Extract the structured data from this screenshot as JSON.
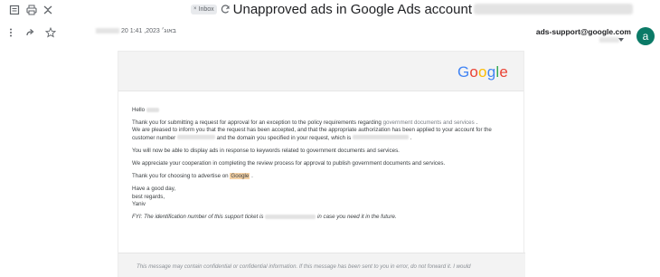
{
  "toolbar": {
    "icons": [
      "print-icon",
      "printer-icon",
      "collapse-icon"
    ]
  },
  "subject": {
    "inbox_chip": "Inbox",
    "chip_close": "×",
    "text": "Unapproved ads in Google Ads account"
  },
  "header": {
    "date": "20 באוג׳ 2023, 1:41",
    "sender": "ads-support@google.com",
    "avatar_letter": "a"
  },
  "email": {
    "logo_letters": [
      "G",
      "o",
      "o",
      "g",
      "l",
      "e"
    ],
    "logo_colors": [
      "#4285F4",
      "#EA4335",
      "#FBBC05",
      "#4285F4",
      "#34A853",
      "#EA4335"
    ],
    "greeting": "Hello",
    "p1_a": "Thank you for submitting a request for approval for an exception to the policy requirements regarding",
    "p1_link": "government documents and services",
    "p1_end": ".",
    "p2_a": "We are pleased to inform you that the request has been accepted, and that the appropriate authorization has been applied to your account for the customer number",
    "p2_b": "and the domain you specified in your request, which is",
    "p2_end": ".",
    "p3": "You will now be able to display ads in response to keywords related to government documents and services.",
    "p4": "We appreciate your cooperation in completing the review process for approval to publish government documents and services.",
    "p5_a": "Thank you for choosing to advertise on",
    "p5_highlight": "Google",
    "p5_end": ".",
    "sign1": "Have a good day,",
    "sign2": "best regards,",
    "sign3": "Yaniv",
    "fyi_a": "FYI: The identification number of this support ticket is",
    "fyi_b": "in case you need it in the future.",
    "footer": "This message may contain confidential or confidential information. If this message has been sent to you in error, do not forward it. I would"
  }
}
